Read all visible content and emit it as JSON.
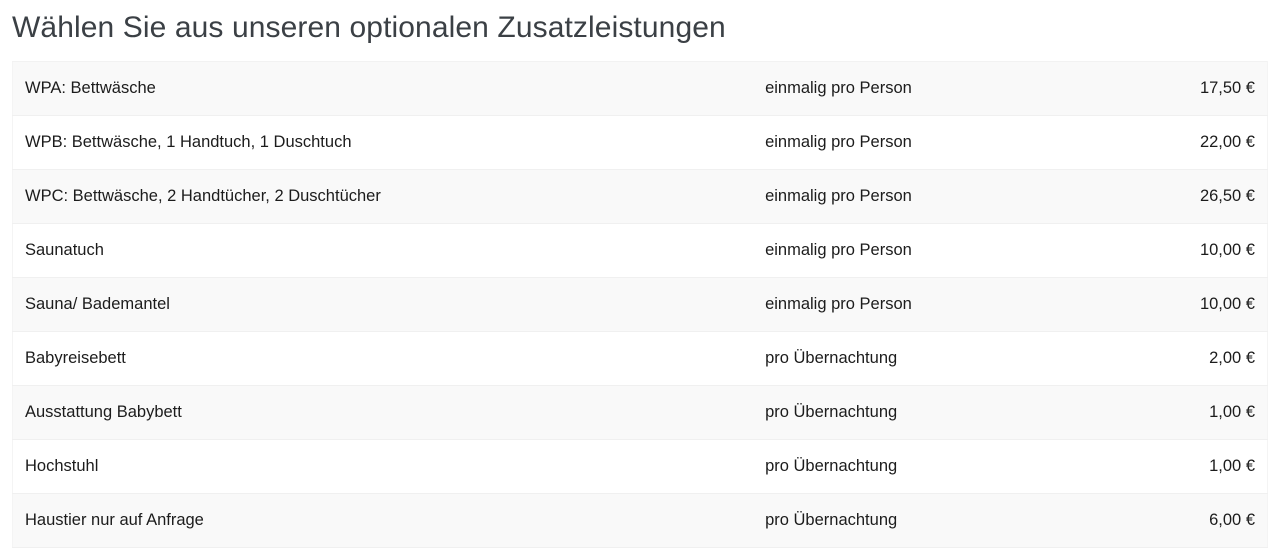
{
  "page": {
    "title": "Wählen Sie aus unseren optionalen Zusatzleistungen",
    "background_color": "#ffffff",
    "title_color": "#3b4045",
    "row_stripe_color": "#f9f9f9",
    "row_border_color": "#f0f0f0"
  },
  "table": {
    "rows": [
      {
        "name": "WPA: Bettwäsche",
        "frequency": "einmalig pro Person",
        "price": "17,50 €"
      },
      {
        "name": "WPB: Bettwäsche, 1 Handtuch, 1 Duschtuch",
        "frequency": "einmalig pro Person",
        "price": "22,00 €"
      },
      {
        "name": "WPC: Bettwäsche, 2 Handtücher, 2 Duschtücher",
        "frequency": "einmalig pro Person",
        "price": "26,50 €"
      },
      {
        "name": "Saunatuch",
        "frequency": "einmalig pro Person",
        "price": "10,00 €"
      },
      {
        "name": "Sauna/ Bademantel",
        "frequency": "einmalig pro Person",
        "price": "10,00 €"
      },
      {
        "name": "Babyreisebett",
        "frequency": "pro Übernachtung",
        "price": "2,00 €"
      },
      {
        "name": "Ausstattung Babybett",
        "frequency": "pro Übernachtung",
        "price": "1,00 €"
      },
      {
        "name": "Hochstuhl",
        "frequency": "pro Übernachtung",
        "price": "1,00 €"
      },
      {
        "name": "Haustier nur auf Anfrage",
        "frequency": "pro Übernachtung",
        "price": "6,00 €"
      }
    ]
  }
}
